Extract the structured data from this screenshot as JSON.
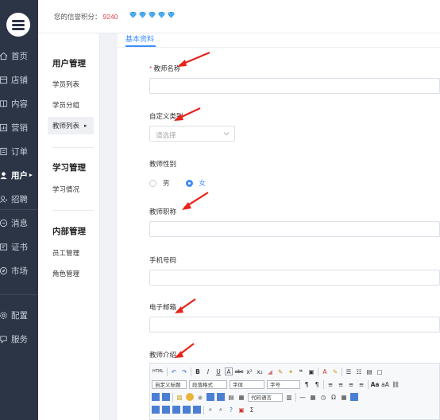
{
  "rail": {
    "items": [
      {
        "label": "首页"
      },
      {
        "label": "店铺"
      },
      {
        "label": "内容"
      },
      {
        "label": "营销"
      },
      {
        "label": "订单"
      },
      {
        "label": "用户"
      },
      {
        "label": "招聘"
      },
      {
        "label": "消息"
      },
      {
        "label": "证书"
      },
      {
        "label": "市场"
      },
      {
        "label": "配置"
      },
      {
        "label": "服务"
      }
    ],
    "active": "用户"
  },
  "topbar": {
    "credit_label": "您的信誉积分：",
    "credit_value": "9240",
    "diamond_count": 5,
    "diamond_color": "#2f9de8"
  },
  "submenu": {
    "groups": [
      {
        "title": "用户管理",
        "items": [
          "学员列表",
          "学员分组",
          "教师列表"
        ]
      },
      {
        "title": "学习管理",
        "items": [
          "学习情况"
        ]
      },
      {
        "title": "内部管理",
        "items": [
          "员工管理",
          "角色管理"
        ]
      }
    ],
    "active_item": "教师列表",
    "active_caret": "▸"
  },
  "form": {
    "tab": "基本资料",
    "name_label": "教师名称",
    "required_mark": "*",
    "category_label": "自定义类别",
    "category_placeholder": "请选择",
    "gender_label": "教师性别",
    "gender_options": [
      "男",
      "女"
    ],
    "gender_selected": "女",
    "title_label": "教师职称",
    "phone_label": "手机号码",
    "email_label": "电子邮箱",
    "intro_label": "教师介绍"
  },
  "editor": {
    "selects": [
      "自定义标题",
      "段落格式",
      "字体",
      "字号",
      "代码语言"
    ],
    "html_label": "HTML"
  },
  "colors": {
    "accent": "#3b8cff",
    "rail_bg": "#2b3546",
    "arrow": "#e8231a",
    "credit": "#e0474b"
  }
}
